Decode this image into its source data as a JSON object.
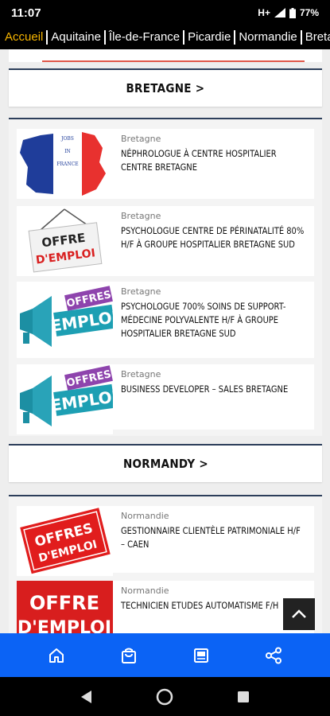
{
  "status": {
    "time": "11:07",
    "network": "H+",
    "battery": "77%"
  },
  "tabs": [
    "Accueil",
    "Aquitaine",
    "Île-de-France",
    "Picardie",
    "Normandie",
    "Bretagne"
  ],
  "sections": [
    {
      "title": "BRETAGNE >",
      "cards": [
        {
          "region": "Bretagne",
          "title": "Néphrologue à centre hospitalier centre Bretagne",
          "thumb": "jobs-in-france-map"
        },
        {
          "region": "Bretagne",
          "title": "Psychologue centre de périnatalité 80% H/F à Groupe Hospitalier Bretagne Sud",
          "thumb": "offre-demploi-sign"
        },
        {
          "region": "Bretagne",
          "title": "Psychologue 700% soins de support-médecine polyvalente H/F à Groupe Hospitalier Bretagne Sud",
          "thumb": "offres-emploi-megaphone"
        },
        {
          "region": "Bretagne",
          "title": "Business Developer – Sales Bretagne",
          "thumb": "offres-emploi-megaphone"
        }
      ]
    },
    {
      "title": "NORMANDY >",
      "cards": [
        {
          "region": "Normandie",
          "title": "Gestionnaire Clientèle Patrimoniale H/F – Caen",
          "thumb": "offres-demploi-stamp"
        },
        {
          "region": "Normandie",
          "title": "Technicien Etudes Automatisme F/H",
          "thumb": "offre-demploi-red"
        }
      ]
    }
  ],
  "thumb_text": {
    "jobs_in_france": [
      "JOBS",
      "IN",
      "FRANCE"
    ],
    "offre_sign": [
      "OFFRE",
      "D'EMPLOI"
    ],
    "offres_emploi": [
      "OFFRES",
      "EMPLOI"
    ],
    "offres_stamp": [
      "OFFRES",
      "D'EMPLOI"
    ],
    "offre_red": [
      "OFFRE",
      "D'EMPLOI"
    ]
  },
  "bottom_nav": [
    "home-icon",
    "shopping-bag-icon",
    "newspaper-icon",
    "share-icon"
  ],
  "colors": {
    "accent": "#f7b500",
    "nav_blue": "#0b63f5",
    "section_border": "#2c3e5a"
  }
}
